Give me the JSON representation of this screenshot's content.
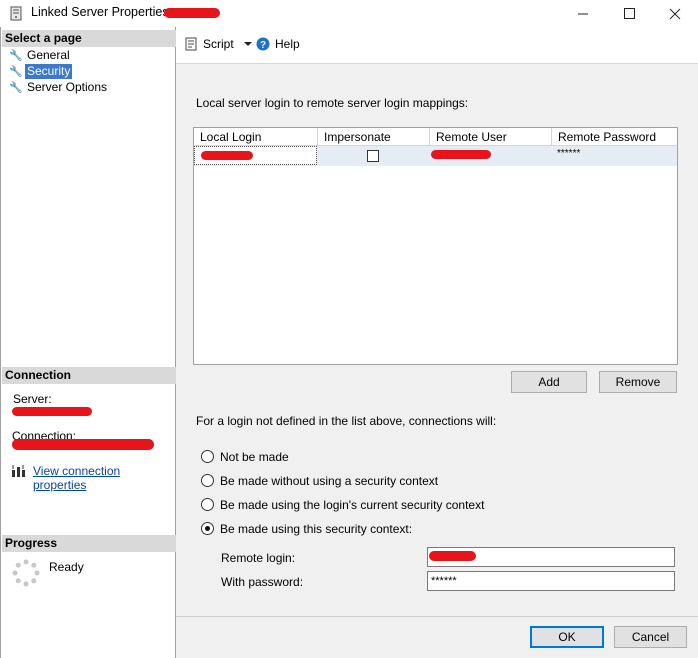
{
  "window": {
    "title": "Linked Server Properties - ",
    "minimize_icon": "minimize-icon",
    "maximize_icon": "maximize-icon",
    "close_icon": "close-icon"
  },
  "sidebar": {
    "select_page_header": "Select a page",
    "pages": [
      {
        "label": "General",
        "icon": "wrench-icon"
      },
      {
        "label": "Security",
        "icon": "wrench-icon",
        "selected": true
      },
      {
        "label": "Server Options",
        "icon": "wrench-icon"
      }
    ],
    "connection_header": "Connection",
    "server_label": "Server:",
    "connection_label": "Connection:",
    "view_connection_link": "View connection properties",
    "progress_header": "Progress",
    "progress_status": "Ready"
  },
  "toolbar": {
    "script_label": "Script",
    "help_label": "Help"
  },
  "security": {
    "mappings_label": "Local server login to remote server login mappings:",
    "columns": [
      "Local Login",
      "Impersonate",
      "Remote User",
      "Remote Password"
    ],
    "rows": [
      {
        "local_login": "",
        "impersonate": false,
        "remote_user": "",
        "remote_password": "******"
      }
    ],
    "add_label": "Add",
    "remove_label": "Remove",
    "undefined_login_label": "For a login not defined in the list above, connections will:",
    "options": [
      {
        "label": "Not be made",
        "selected": false
      },
      {
        "label": "Be made without using a security context",
        "selected": false
      },
      {
        "label": "Be made using the login's current security context",
        "selected": false
      },
      {
        "label": "Be made using this security context:",
        "selected": true
      }
    ],
    "remote_login_label": "Remote login:",
    "remote_login_value": "",
    "with_password_label": "With password:",
    "with_password_value": "******"
  },
  "footer": {
    "ok_label": "OK",
    "cancel_label": "Cancel"
  },
  "colors": {
    "selection": "#3b79d0",
    "redaction": "#e8141b"
  }
}
